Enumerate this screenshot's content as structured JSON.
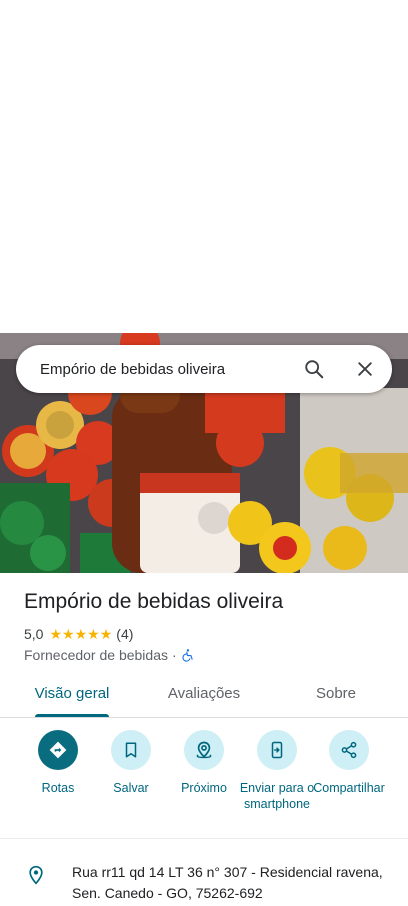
{
  "search": {
    "value": "Empório de bebidas oliveira"
  },
  "place": {
    "name": "Empório de bebidas oliveira",
    "rating": "5,0",
    "stars": 5,
    "review_count": "(4)",
    "category": "Fornecedor de bebidas",
    "separator": "·"
  },
  "tabs": [
    {
      "label": "Visão geral",
      "active": true
    },
    {
      "label": "Avaliações",
      "active": false
    },
    {
      "label": "Sobre",
      "active": false
    }
  ],
  "actions": [
    {
      "label": "Rotas",
      "icon": "directions-icon"
    },
    {
      "label": "Salvar",
      "icon": "bookmark-icon"
    },
    {
      "label": "Próximo",
      "icon": "nearby-icon"
    },
    {
      "label": "Enviar para o smartphone",
      "icon": "send-to-phone-icon"
    },
    {
      "label": "Compartilhar",
      "icon": "share-icon"
    }
  ],
  "address": {
    "text": "Rua rr11 qd 14 LT 36 n° 307 - Residencial ravena, Sen. Canedo - GO, 75262-692",
    "icon": "location-pin-icon"
  },
  "colors": {
    "accent": "#00677e",
    "primary_action": "#0a6d7f",
    "action_bg": "#cdeff5",
    "star": "#f6b400"
  }
}
